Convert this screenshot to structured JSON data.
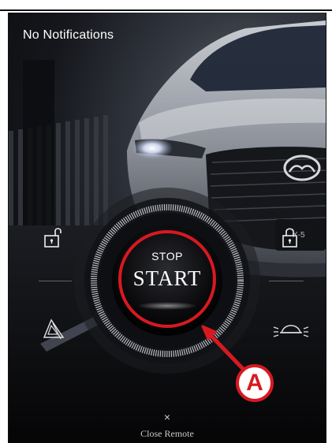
{
  "notifications": {
    "text": "No Notifications"
  },
  "car": {
    "badge_text": "X-5"
  },
  "remote": {
    "stop_label": "STOP",
    "start_label": "START"
  },
  "controls": {
    "lock_left_icon": "padlock-unlocked-icon",
    "lock_right_icon": "padlock-locked-icon",
    "hazard_icon": "hazard-triangle-icon",
    "lights_icon": "car-flashing-lights-icon"
  },
  "annotation": {
    "letter": "A",
    "color": "#d71921"
  },
  "footer": {
    "close_symbol": "×",
    "close_label": "Close Remote"
  }
}
